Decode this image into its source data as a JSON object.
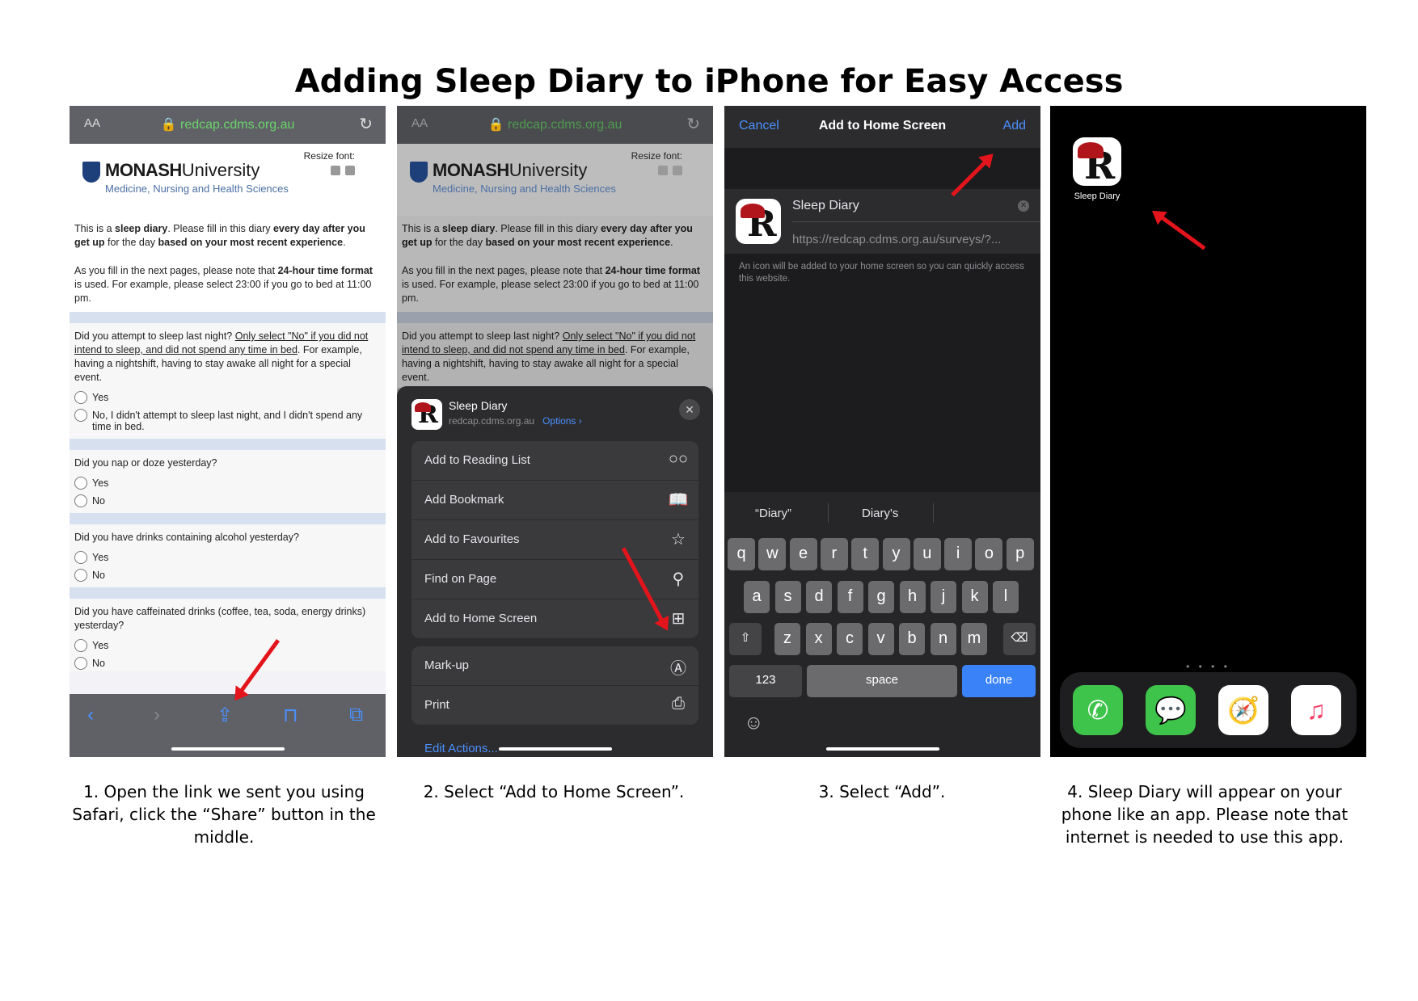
{
  "title": "Adding Sleep Diary to iPhone for Easy Access",
  "colors": {
    "accent": "#4a90ff",
    "arrow": "#e3141b",
    "header_bar": "#5f6166"
  },
  "panel1": {
    "aa": "AA",
    "url": "redcap.cdms.org.au",
    "resize_font": "Resize font:",
    "logo_main": "MONASH",
    "logo_main2": "University",
    "logo_sub": "Medicine, Nursing and Health Sciences",
    "intro_a1": "This is a ",
    "intro_a2": "sleep diary",
    "intro_a3": ". Please fill in this diary ",
    "intro_a4": "every day after you get up",
    "intro_a5": " for the day ",
    "intro_a6": "based on your most recent experience",
    "intro_a7": ".",
    "intro_b1": "As you fill in the next pages, please note that ",
    "intro_b2": "24-hour time format",
    "intro_b3": " is used. For example, please select 23:00 if you go to bed at 11:00 pm.",
    "q1_a": "Did you attempt to sleep last night? ",
    "q1_b": "Only select \"No\" if you did not intend to sleep, and did not spend any time in bed",
    "q1_c": ". For example, having a nightshift, having to stay awake all night for a special event.",
    "q1_yes": "Yes",
    "q1_no": "No, I didn't attempt to sleep last night, and I didn't spend any time in bed.",
    "q2": "Did you nap or doze yesterday?",
    "q3": "Did you have drinks containing alcohol yesterday?",
    "q4": "Did you have caffeinated drinks (coffee, tea, soda, energy drinks) yesterday?",
    "yes": "Yes",
    "no": "No"
  },
  "panel2": {
    "app_name": "Sleep Diary",
    "app_url": "redcap.cdms.org.au",
    "options": "Options ›",
    "actions": [
      {
        "label": "Add to Reading List",
        "icon": "glasses-icon"
      },
      {
        "label": "Add Bookmark",
        "icon": "book-icon"
      },
      {
        "label": "Add to Favourites",
        "icon": "star-icon"
      },
      {
        "label": "Find on Page",
        "icon": "search-icon"
      },
      {
        "label": "Add to Home Screen",
        "icon": "add-square-icon"
      }
    ],
    "actions2": [
      {
        "label": "Mark-up",
        "icon": "markup-icon"
      },
      {
        "label": "Print",
        "icon": "printer-icon"
      }
    ],
    "edit_actions": "Edit Actions..."
  },
  "panel3": {
    "cancel": "Cancel",
    "nav_title": "Add to Home Screen",
    "add": "Add",
    "name": "Sleep Diary",
    "url": "https://redcap.cdms.org.au/surveys/?...",
    "note": "An icon will be added to your home screen so you can quickly access this website.",
    "suggestion_1": "“Diary”",
    "suggestion_2": "Diary's",
    "row1": [
      "q",
      "w",
      "e",
      "r",
      "t",
      "y",
      "u",
      "i",
      "o",
      "p"
    ],
    "row2": [
      "a",
      "s",
      "d",
      "f",
      "g",
      "h",
      "j",
      "k",
      "l"
    ],
    "row3": [
      "z",
      "x",
      "c",
      "v",
      "b",
      "n",
      "m"
    ],
    "key_123": "123",
    "key_space": "space",
    "key_done": "done"
  },
  "panel4": {
    "app_label": "Sleep Diary",
    "page_dots": "• • • •"
  },
  "captions": {
    "c1": "1. Open the link we sent you using Safari, click the “Share” button in the middle.",
    "c2": "2. Select “Add to Home Screen”.",
    "c3": "3. Select “Add”.",
    "c4": "4. Sleep Diary will appear on your phone like an app. Please note that internet is needed to use this app."
  }
}
